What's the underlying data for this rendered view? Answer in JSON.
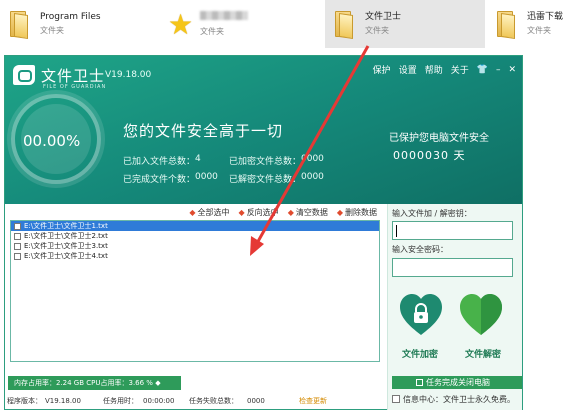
{
  "explorer": {
    "items": [
      {
        "name": "Program Files",
        "type": "文件夹"
      },
      {
        "name": "",
        "type": "文件夹"
      },
      {
        "name": "文件卫士",
        "type": "文件夹"
      },
      {
        "name": "迅雷下载",
        "type": "文件夹"
      }
    ]
  },
  "app": {
    "title": "文件卫士",
    "subtitle": "FILE OF GUARDIAN",
    "version": "V19.18.00",
    "topbar": {
      "protect": "保护",
      "settings": "设置",
      "help": "帮助",
      "about": "关于",
      "skin": "👕",
      "minimize": "–",
      "close": "✕"
    },
    "percent": "00.00%",
    "slogan": "您的文件安全高于一切",
    "stats": {
      "added_label": "已加入文件总数：",
      "added_value": "4",
      "encrypted_label": "已加密文件总数：",
      "encrypted_value": "0000",
      "done_label": "已完成文件个数：",
      "done_value": "0000",
      "decrypted_label": "已解密文件总数：",
      "decrypted_value": "0000"
    },
    "protected_label": "已保护您电脑文件安全",
    "protected_value": "0000030",
    "protected_unit": "天",
    "toolbar": {
      "select_all": "全部选中",
      "invert": "反向选中",
      "clear": "清空数据",
      "delete": "删除数据"
    },
    "files": [
      "E:\\文件卫士\\文件卫士1.txt",
      "E:\\文件卫士\\文件卫士2.txt",
      "E:\\文件卫士\\文件卫士3.txt",
      "E:\\文件卫士\\文件卫士4.txt"
    ],
    "status": "内存占用率：2.24 GB   CPU占用率：3.66 %",
    "status_arrow": "◆",
    "bottom": {
      "version_label": "程序版本：",
      "version_value": "V19.18.00",
      "time_label": "任务用时：",
      "time_value": "00:00:00",
      "fail_label": "任务失败总数：",
      "fail_value": "0000",
      "update": "检查更新"
    },
    "right_panel": {
      "path_label": "输入文件加 / 解密钥：",
      "password_label": "输入安全密码：",
      "encrypt_label": "文件加密",
      "decrypt_label": "文件解密",
      "shutdown_label": "任务完成关闭电脑",
      "info_label": "信息中心：文件卫士永久免费。"
    }
  },
  "colors": {
    "header": "#1a9a82",
    "accent": "#2e9b5a",
    "arrow": "#e53935"
  }
}
